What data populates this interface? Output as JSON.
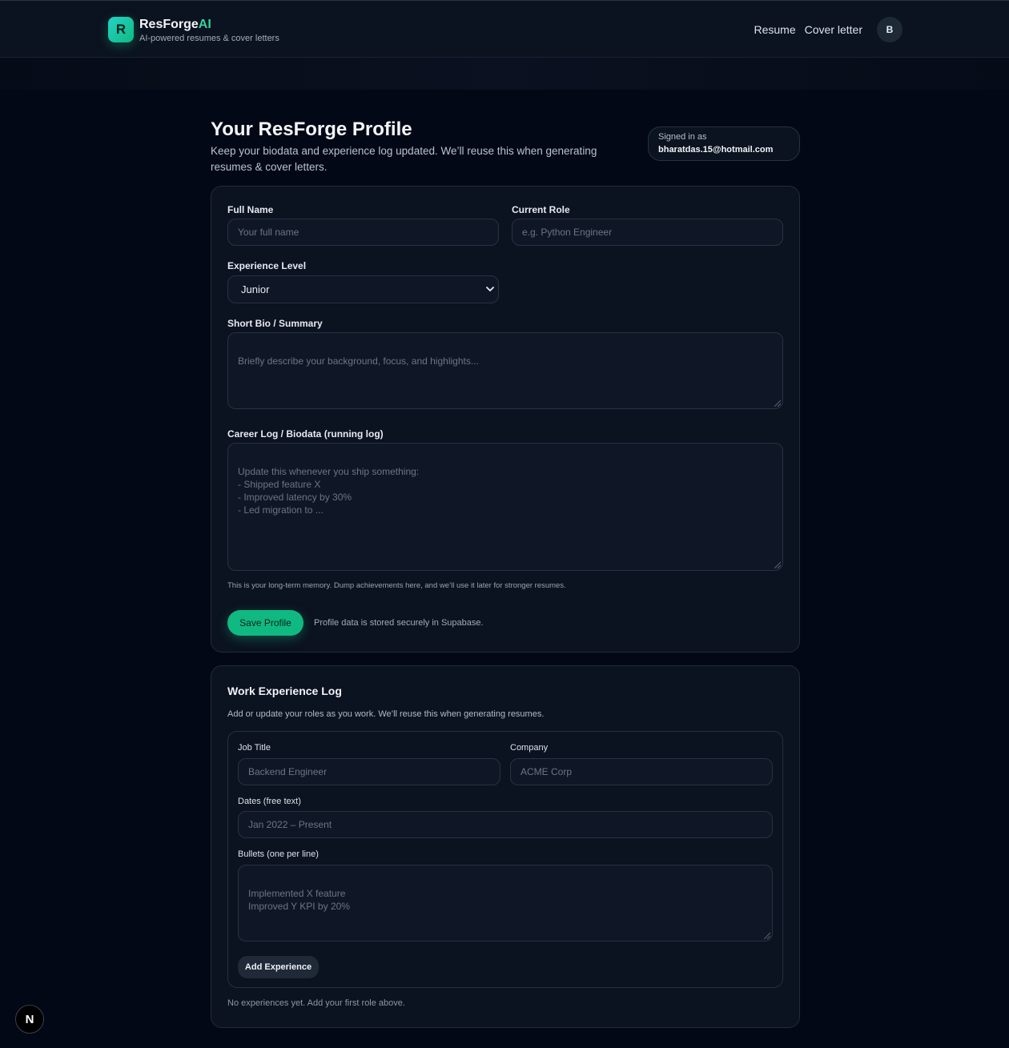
{
  "brand": {
    "logo_letter": "R",
    "name_main": "ResForge",
    "name_accent": "AI",
    "tagline": "AI-powered resumes & cover letters"
  },
  "nav": {
    "items": [
      "Resume",
      "Cover letter"
    ],
    "avatar_letter": "B"
  },
  "header": {
    "title": "Your ResForge Profile",
    "subtitle": "Keep your biodata and experience log updated. We’ll reuse this when generating resumes & cover letters.",
    "signed_in_label": "Signed in as",
    "email": "bharatdas.15@hotmail.com"
  },
  "profile": {
    "full_name_label": "Full Name",
    "full_name_placeholder": "Your full name",
    "current_role_label": "Current Role",
    "current_role_placeholder": "e.g. Python Engineer",
    "experience_label": "Experience Level",
    "experience_value": "Junior",
    "bio_label": "Short Bio / Summary",
    "bio_placeholder": "Briefly describe your background, focus, and highlights...",
    "career_label": "Career Log / Biodata (running log)",
    "career_placeholder": "Update this whenever you ship something:\n- Shipped feature X\n- Improved latency by 30%\n- Led migration to ...",
    "career_hint": "This is your long-term memory. Dump achievements here, and we’ll use it later for stronger resumes.",
    "save_label": "Save Profile",
    "save_note": "Profile data is stored securely in Supabase."
  },
  "work": {
    "title": "Work Experience Log",
    "subtitle": "Add or update your roles as you work. We’ll reuse this when generating resumes.",
    "job_title_label": "Job Title",
    "job_title_placeholder": "Backend Engineer",
    "company_label": "Company",
    "company_placeholder": "ACME Corp",
    "dates_label": "Dates (free text)",
    "dates_placeholder": "Jan 2022 – Present",
    "bullets_label": "Bullets (one per line)",
    "bullets_placeholder": "Implemented X feature\nImproved Y KPI by 20%",
    "add_label": "Add Experience",
    "empty_text": "No experiences yet. Add your first role above."
  },
  "badge": {
    "letter": "N"
  },
  "colors": {
    "accent": "#10b981",
    "background": "#030816",
    "card": "#0b1220"
  }
}
